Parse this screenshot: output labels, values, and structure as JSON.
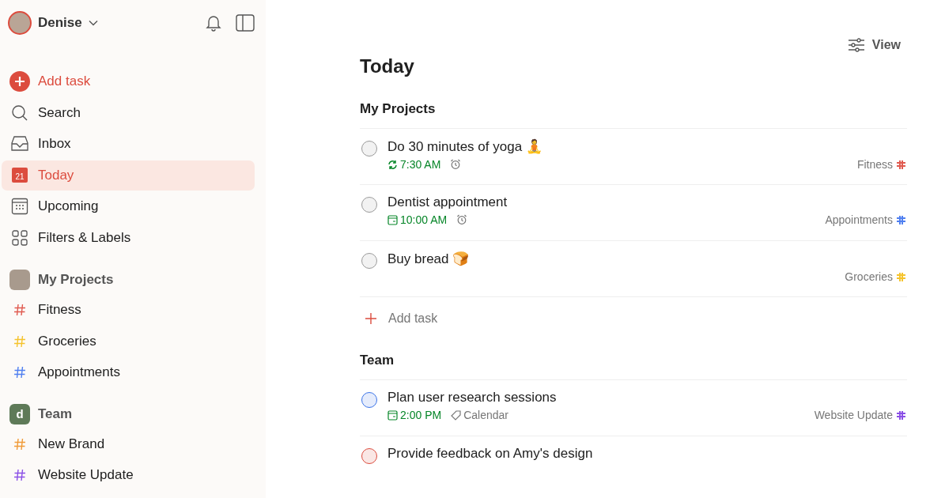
{
  "sidebar": {
    "user": {
      "name": "Denise"
    },
    "nav": [
      {
        "kind": "add",
        "label": "Add task",
        "selected": false
      },
      {
        "kind": "search",
        "label": "Search",
        "selected": false
      },
      {
        "kind": "inbox",
        "label": "Inbox",
        "selected": false
      },
      {
        "kind": "today",
        "label": "Today",
        "selected": true,
        "badge": "21"
      },
      {
        "kind": "upcoming",
        "label": "Upcoming",
        "selected": false
      },
      {
        "kind": "filters",
        "label": "Filters & Labels",
        "selected": false
      }
    ],
    "groups": [
      {
        "kind": "personal",
        "title": "My Projects",
        "projects": [
          {
            "name": "Fitness",
            "color": "#e05a4f"
          },
          {
            "name": "Groceries",
            "color": "#f5c32c"
          },
          {
            "name": "Appointments",
            "color": "#4f7ff0"
          }
        ]
      },
      {
        "kind": "team",
        "title": "Team",
        "avatar_letter": "d",
        "projects": [
          {
            "name": "New Brand",
            "color": "#f09a37"
          },
          {
            "name": "Website Update",
            "color": "#8a4fe6"
          }
        ]
      }
    ]
  },
  "main": {
    "view_button": "View",
    "title": "Today",
    "sections": [
      {
        "title": "My Projects",
        "add_task": "Add task",
        "tasks": [
          {
            "title": "Do 30 minutes of yoga 🧘",
            "color": "#9a9a9a",
            "due": {
              "kind": "recurring",
              "text": "7:30 AM"
            },
            "reminder": true,
            "project": {
              "name": "Fitness",
              "color": "#e05a4f"
            }
          },
          {
            "title": "Dentist appointment",
            "color": "#9a9a9a",
            "due": {
              "kind": "date",
              "text": "10:00 AM"
            },
            "reminder": true,
            "project": {
              "name": "Appointments",
              "color": "#4f7ff0"
            }
          },
          {
            "title": "Buy bread 🍞",
            "color": "#9a9a9a",
            "reminder": false,
            "project": {
              "name": "Groceries",
              "color": "#f5c32c"
            }
          }
        ]
      },
      {
        "title": "Team",
        "tasks": [
          {
            "title": "Plan user research sessions",
            "color": "#3b74e8",
            "due": {
              "kind": "date",
              "text": "2:00 PM"
            },
            "reminder": false,
            "label": "Calendar",
            "project": {
              "name": "Website Update",
              "color": "#8a4fe6"
            }
          },
          {
            "title": "Provide feedback on Amy's design",
            "color": "#dc4c3e",
            "reminder": false
          }
        ]
      }
    ]
  }
}
